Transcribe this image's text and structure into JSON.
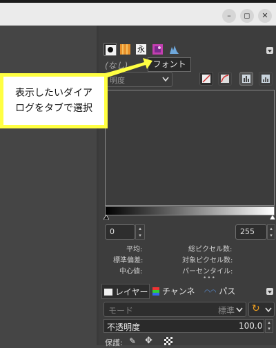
{
  "window": {
    "minimize_glyph": "–",
    "maximize_glyph": "◻",
    "close_glyph": "✕"
  },
  "dock_tabs": [
    {
      "name": "tab-brushes",
      "icon": "brush-dot-icon"
    },
    {
      "name": "tab-patterns",
      "icon": "pattern-icon"
    },
    {
      "name": "tab-fonts",
      "icon": "font-icon",
      "glyph": "永"
    },
    {
      "name": "tab-images",
      "icon": "image-icon"
    },
    {
      "name": "tab-histogram",
      "icon": "histogram-icon"
    }
  ],
  "tooltip": "フォント",
  "callout": {
    "line1": "表示したいダイア",
    "line2": "ログをタブで選択"
  },
  "histogram": {
    "drawable": "(なし)",
    "channel": "明度",
    "range_min": "0",
    "range_max": "255",
    "stats": {
      "mean_label": "平均:",
      "std_label": "標準偏差:",
      "median_label": "中心値:",
      "pixels_label": "総ピクセル数:",
      "count_label": "対象ピクセル数:",
      "percentile_label": "パーセンタイル:"
    }
  },
  "layers_dock": {
    "tab_layers": "レイヤー",
    "tab_channels": "チャンネル",
    "tab_paths": "パス",
    "mode_label": "モード",
    "mode_value": "標準",
    "opacity_label": "不透明度",
    "opacity_value": "100.0",
    "lock_label": "保護:"
  },
  "colors": {
    "callout_border": "#ffff42",
    "panel_bg": "#3d3d3d"
  }
}
